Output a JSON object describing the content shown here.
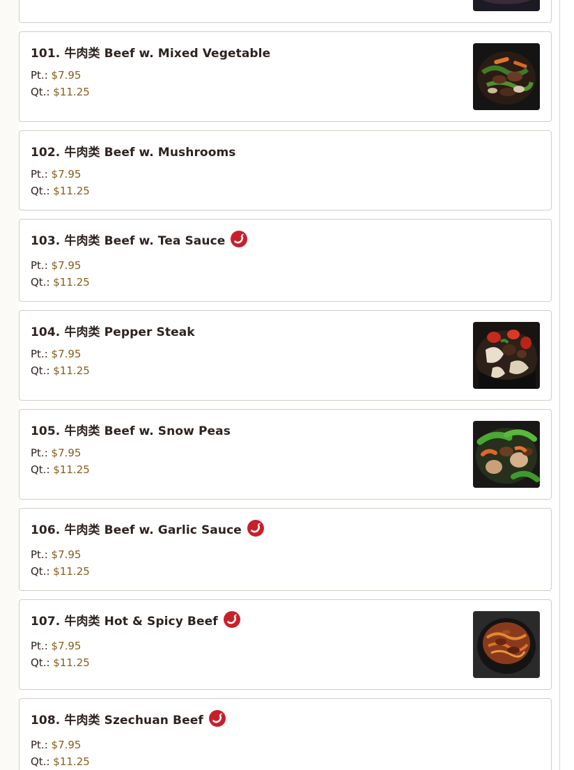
{
  "items": [
    {
      "title": "",
      "pt_label": "",
      "pt_price": "",
      "qt_label": "",
      "qt_price": "",
      "spicy": false,
      "photo": "bowl-photo"
    },
    {
      "title": "101. 牛肉类 Beef w. Mixed Vegetable",
      "pt_label": "Pt.:",
      "pt_price": "$7.95",
      "qt_label": "Qt.:",
      "qt_price": "$11.25",
      "spicy": false,
      "photo": "mixed-vegetable-beef-photo"
    },
    {
      "title": "102. 牛肉类 Beef w. Mushrooms",
      "pt_label": "Pt.:",
      "pt_price": "$7.95",
      "qt_label": "Qt.:",
      "qt_price": "$11.25",
      "spicy": false,
      "photo": ""
    },
    {
      "title": "103. 牛肉类 Beef w. Tea Sauce",
      "pt_label": "Pt.:",
      "pt_price": "$7.95",
      "qt_label": "Qt.:",
      "qt_price": "$11.25",
      "spicy": true,
      "photo": ""
    },
    {
      "title": "104. 牛肉类 Pepper Steak",
      "pt_label": "Pt.:",
      "pt_price": "$7.95",
      "qt_label": "Qt.:",
      "qt_price": "$11.25",
      "spicy": false,
      "photo": "pepper-steak-photo"
    },
    {
      "title": "105. 牛肉类 Beef w. Snow Peas",
      "pt_label": "Pt.:",
      "pt_price": "$7.95",
      "qt_label": "Qt.:",
      "qt_price": "$11.25",
      "spicy": false,
      "photo": "snow-peas-beef-photo"
    },
    {
      "title": "106. 牛肉类 Beef w. Garlic Sauce",
      "pt_label": "Pt.:",
      "pt_price": "$7.95",
      "qt_label": "Qt.:",
      "qt_price": "$11.25",
      "spicy": true,
      "photo": ""
    },
    {
      "title": "107. 牛肉类 Hot & Spicy Beef",
      "pt_label": "Pt.:",
      "pt_price": "$7.95",
      "qt_label": "Qt.:",
      "qt_price": "$11.25",
      "spicy": true,
      "photo": "hot-spicy-beef-photo"
    },
    {
      "title": "108. 牛肉类 Szechuan Beef",
      "pt_label": "Pt.:",
      "pt_price": "$7.95",
      "qt_label": "Qt.:",
      "qt_price": "$11.25",
      "spicy": true,
      "photo": ""
    }
  ],
  "colors": {
    "title": "#2e2320",
    "price": "#8a5a1a",
    "spicy_badge": "#c8202a",
    "card_border": "#d2cec7"
  },
  "icons": {
    "spicy": "chili-pepper-icon"
  }
}
